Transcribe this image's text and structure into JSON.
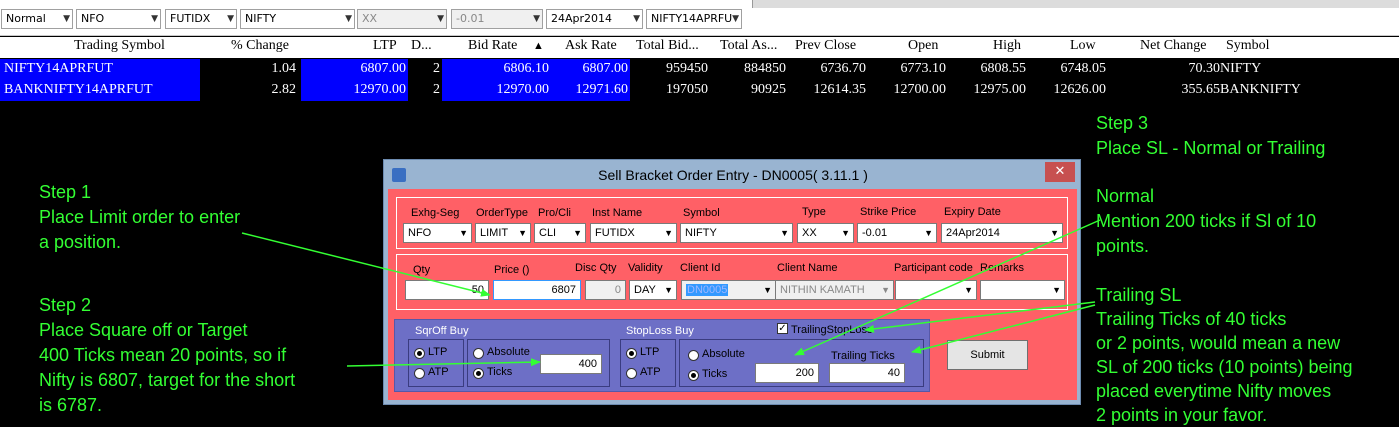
{
  "filters": [
    {
      "value": "Normal",
      "enabled": true
    },
    {
      "value": "NFO",
      "enabled": true
    },
    {
      "value": "FUTIDX",
      "enabled": true
    },
    {
      "value": "NIFTY",
      "enabled": true
    },
    {
      "value": "XX",
      "enabled": false
    },
    {
      "value": "-0.01",
      "enabled": false
    },
    {
      "value": "24Apr2014",
      "enabled": true
    },
    {
      "value": "NIFTY14APRFU",
      "enabled": true
    }
  ],
  "grid": {
    "headers": [
      "Trading Symbol",
      "% Change",
      "LTP",
      "D...",
      "Bid Rate",
      "Ask Rate",
      "Total Bid...",
      "Total As...",
      "Prev Close",
      "Open",
      "High",
      "Low",
      "Net Change",
      "Symbol"
    ],
    "sort_indicator": "▲",
    "rows": [
      [
        "NIFTY14APRFUT",
        "1.04",
        "6807.00",
        "2",
        "6806.10",
        "6807.00",
        "959450",
        "884850",
        "6736.70",
        "6773.10",
        "6808.55",
        "6748.05",
        "70.30",
        "NIFTY"
      ],
      [
        "BANKNIFTY14APRFUT",
        "2.82",
        "12970.00",
        "2",
        "12970.00",
        "12971.60",
        "197050",
        "90925",
        "12614.35",
        "12700.00",
        "12975.00",
        "12626.00",
        "355.65",
        "BANKNIFTY"
      ]
    ]
  },
  "annotations": {
    "step1": [
      "Step 1",
      "Place Limit order to enter",
      "a position."
    ],
    "step2": [
      "Step 2",
      "Place Square off or Target",
      "400 Ticks mean 20 points, so if",
      "Nifty is 6807, target for the short",
      "is 6787."
    ],
    "step3": [
      "Step 3",
      "Place SL - Normal or Trailing"
    ],
    "normal": [
      "Normal",
      "Mention 200 ticks if Sl of 10",
      "points."
    ],
    "trailing": [
      "Trailing SL",
      "Trailing Ticks of 40 ticks",
      "or 2 points, would mean a new",
      "SL of 200 ticks (10 points) being",
      "placed everytime Nifty moves",
      "2 points in your favor."
    ]
  },
  "dialog": {
    "title": "Sell Bracket Order Entry - DN0005( 3.11.1 )",
    "close": "✕",
    "row1": {
      "labels": {
        "exch": "Exhg-Seg",
        "ordertype": "OrderType",
        "procli": "Pro/Cli",
        "inst": "Inst Name",
        "symbol": "Symbol",
        "type": "Type",
        "strike": "Strike Price",
        "expiry": "Expiry Date"
      },
      "values": {
        "exch": "NFO",
        "ordertype": "LIMIT",
        "procli": "CLI",
        "inst": "FUTIDX",
        "symbol": "NIFTY",
        "type": "XX",
        "strike": "-0.01",
        "expiry": "24Apr2014"
      }
    },
    "row2": {
      "labels": {
        "qty": "Qty",
        "price": "Price ()",
        "discqty": "Disc Qty",
        "validity": "Validity",
        "clientid": "Client Id",
        "clientname": "Client Name",
        "participant": "Participant code",
        "remarks": "Remarks"
      },
      "values": {
        "qty": "50",
        "price": "6807",
        "discqty": "0",
        "validity": "DAY",
        "clientid": "DN0005",
        "clientname": "NITHIN KAMATH",
        "participant": "",
        "remarks": ""
      }
    },
    "sqroff": {
      "label": "SqrOff Buy",
      "ltp": "LTP",
      "atp": "ATP",
      "absolute": "Absolute",
      "ticks": "Ticks",
      "value": "400"
    },
    "stoploss": {
      "label": "StopLoss Buy",
      "ltp": "LTP",
      "atp": "ATP",
      "absolute": "Absolute",
      "ticks": "Ticks",
      "value": "200",
      "trailing_label": "TrailingStopLoss",
      "trailing_checked": true,
      "trailing_ticks_label": "Trailing Ticks",
      "trailing_ticks_value": "40"
    },
    "submit": "Submit"
  },
  "colors": {
    "arrow": "#33ff33",
    "highlight": "#0000ff",
    "dialog_body": "#ff6066",
    "panel": "#6d6fc6"
  }
}
